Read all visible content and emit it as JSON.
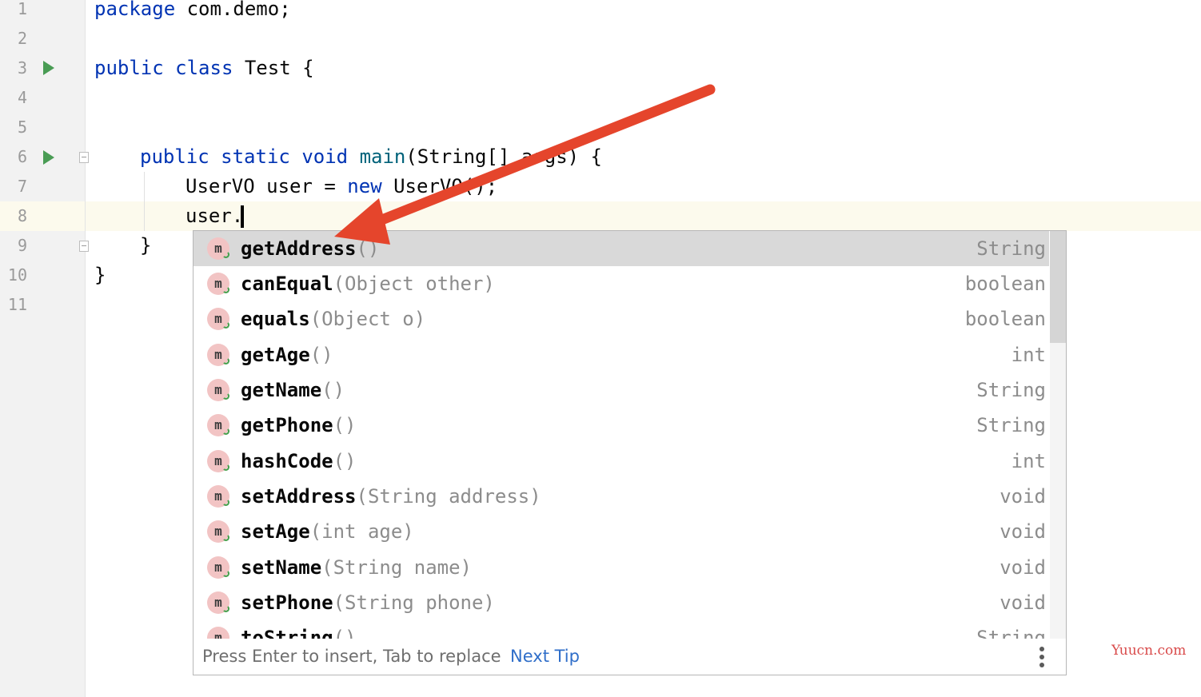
{
  "editor": {
    "line_numbers": [
      "1",
      "2",
      "3",
      "4",
      "5",
      "6",
      "7",
      "8",
      "9",
      "10",
      "11"
    ],
    "lines": {
      "l1": {
        "kw": "package",
        "rest": " com.demo;"
      },
      "l3": {
        "kw1": "public",
        "kw2": "class",
        "rest": " Test {"
      },
      "l6": {
        "kw1": "public",
        "kw2": "static",
        "kw3": "void",
        "fn": "main",
        "rest": "(String[] args) {"
      },
      "l7": {
        "pre": "UserVO user = ",
        "kw": "new",
        "rest": " UserVO();"
      },
      "l8": {
        "text": "user."
      },
      "l9": {
        "text": "}"
      },
      "l10": {
        "text": "}"
      }
    }
  },
  "completion": {
    "items": [
      {
        "name": "getAddress",
        "params": "()",
        "type": "String",
        "selected": true
      },
      {
        "name": "canEqual",
        "params": "(Object other)",
        "type": "boolean"
      },
      {
        "name": "equals",
        "params": "(Object o)",
        "type": "boolean"
      },
      {
        "name": "getAge",
        "params": "()",
        "type": "int"
      },
      {
        "name": "getName",
        "params": "()",
        "type": "String"
      },
      {
        "name": "getPhone",
        "params": "()",
        "type": "String"
      },
      {
        "name": "hashCode",
        "params": "()",
        "type": "int"
      },
      {
        "name": "setAddress",
        "params": "(String address)",
        "type": "void"
      },
      {
        "name": "setAge",
        "params": "(int age)",
        "type": "void"
      },
      {
        "name": "setName",
        "params": "(String name)",
        "type": "void"
      },
      {
        "name": "setPhone",
        "params": "(String phone)",
        "type": "void"
      },
      {
        "name": "toString",
        "params": "()",
        "type": "String"
      }
    ],
    "icon_letter": "m",
    "footer_hint": "Press Enter to insert, Tab to replace",
    "next_tip": "Next Tip"
  },
  "watermark": "Yuucn.com",
  "colors": {
    "keyword": "#0033b3",
    "function": "#00627a",
    "run": "#499c54",
    "arrow": "#e5452c",
    "link": "#2f6ec9"
  }
}
